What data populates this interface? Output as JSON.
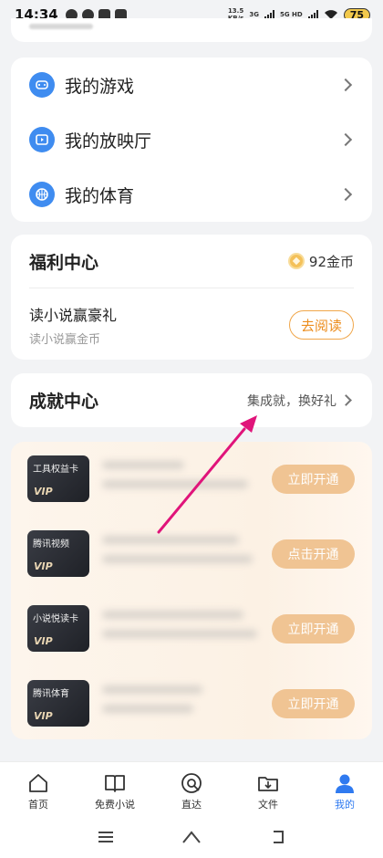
{
  "status_bar": {
    "time": "14:34",
    "net_speed_value": "13.5",
    "net_speed_unit": "KB/s",
    "gen1": "3G",
    "gen2": "5G HD",
    "battery": "75"
  },
  "menu": {
    "items": [
      {
        "label": "我的游戏",
        "icon": "gamepad-icon"
      },
      {
        "label": "我的放映厅",
        "icon": "play-screen-icon"
      },
      {
        "label": "我的体育",
        "icon": "basketball-icon"
      }
    ]
  },
  "welfare": {
    "title": "福利中心",
    "coins": "92金币",
    "task_title": "读小说赢豪礼",
    "task_sub": "读小说赢金币",
    "task_button": "去阅读"
  },
  "achievement": {
    "title": "成就中心",
    "subtitle": "集成就，换好礼"
  },
  "vip_list": [
    {
      "badge_name": "工具权益卡",
      "badge_vip": "VIP",
      "button": "立即开通"
    },
    {
      "badge_name": "腾讯视频",
      "badge_vip": "VIP",
      "button": "点击开通"
    },
    {
      "badge_name": "小说悦读卡",
      "badge_vip": "VIP",
      "button": "立即开通"
    },
    {
      "badge_name": "腾讯体育",
      "badge_vip": "VIP",
      "button": "立即开通"
    }
  ],
  "bottom_nav": [
    {
      "label": "首页",
      "icon": "home-icon"
    },
    {
      "label": "免费小说",
      "icon": "book-icon"
    },
    {
      "label": "直达",
      "icon": "search-circle-icon"
    },
    {
      "label": "文件",
      "icon": "folder-download-icon"
    },
    {
      "label": "我的",
      "icon": "person-icon",
      "active": true
    }
  ],
  "colors": {
    "accent_blue": "#3f8cf0",
    "coin_gold": "#f4c15a",
    "read_button_orange": "#ec8d1e",
    "vip_button": "#f0c493",
    "arrow_magenta": "#e0147a"
  }
}
